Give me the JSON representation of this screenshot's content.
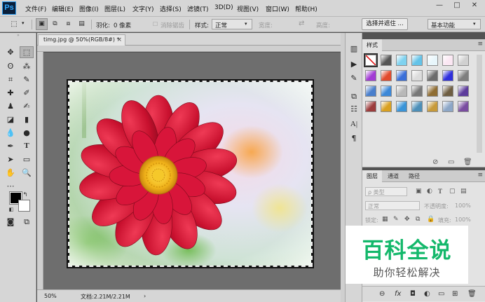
{
  "app": {
    "logo": "Ps",
    "menu": [
      "文件(F)",
      "编辑(E)",
      "图像(I)",
      "图层(L)",
      "文字(Y)",
      "选择(S)",
      "滤镜(T)",
      "3D(D)",
      "视图(V)",
      "窗口(W)",
      "帮助(H)"
    ],
    "window_controls": {
      "minimize": "—",
      "restore": "□",
      "close": "✕"
    }
  },
  "options_bar": {
    "feather_label": "羽化:",
    "feather_value": "0 像素",
    "antialias_label": "消除锯齿",
    "style_label": "样式:",
    "style_value": "正常",
    "width_label": "宽度:",
    "height_label": "高度:",
    "select_mask_button": "选择并遮住 ...",
    "workspace_value": "基本功能"
  },
  "document": {
    "tab_title": "timg.jpg @ 50%(RGB/8#) *",
    "tab_close": "×",
    "zoom": "50%",
    "doc_info": "文档:2.21M/2.21M"
  },
  "styles_panel": {
    "tab_label": "样式",
    "menu_icon": "≡",
    "swatches": [
      [
        "#ffffff",
        "#555555",
        "#7fd2ef",
        "#64c3e8",
        "#e8f6fb",
        "#fbe7f3",
        "#d0d0d0"
      ],
      [
        "#a23bd4",
        "#e14a2c",
        "#3a6fd8",
        "#dcdcdc",
        "#6c6c6c",
        "#2f2fdc",
        "#7f7f7f"
      ],
      [
        "#4a7fcc",
        "#3c88d8",
        "#b8b8b8",
        "#787878",
        "#8f6d33",
        "#6e5e42",
        "#5d3c9c"
      ],
      [
        "#9c3c3c",
        "#d9a020",
        "#3a94d8",
        "#4d8fb8",
        "#c79a3a",
        "#8da7c7",
        "#7a4da0"
      ]
    ]
  },
  "layers_panel": {
    "tabs": [
      "图层",
      "通道",
      "路径"
    ],
    "menu_icon": "≡",
    "filter_label": "ρ 类型",
    "blend_mode": "正常",
    "opacity_label": "不透明度:",
    "opacity_value": "100%",
    "lock_label": "锁定:",
    "fill_label": "填充:",
    "fill_value": "100%",
    "footer_icons": [
      "⊖",
      "fx",
      "◘",
      "◐",
      "▭",
      "⊞",
      "🗑"
    ]
  },
  "watermark": {
    "title": "百科全说",
    "subtitle": "助你轻松解决"
  }
}
